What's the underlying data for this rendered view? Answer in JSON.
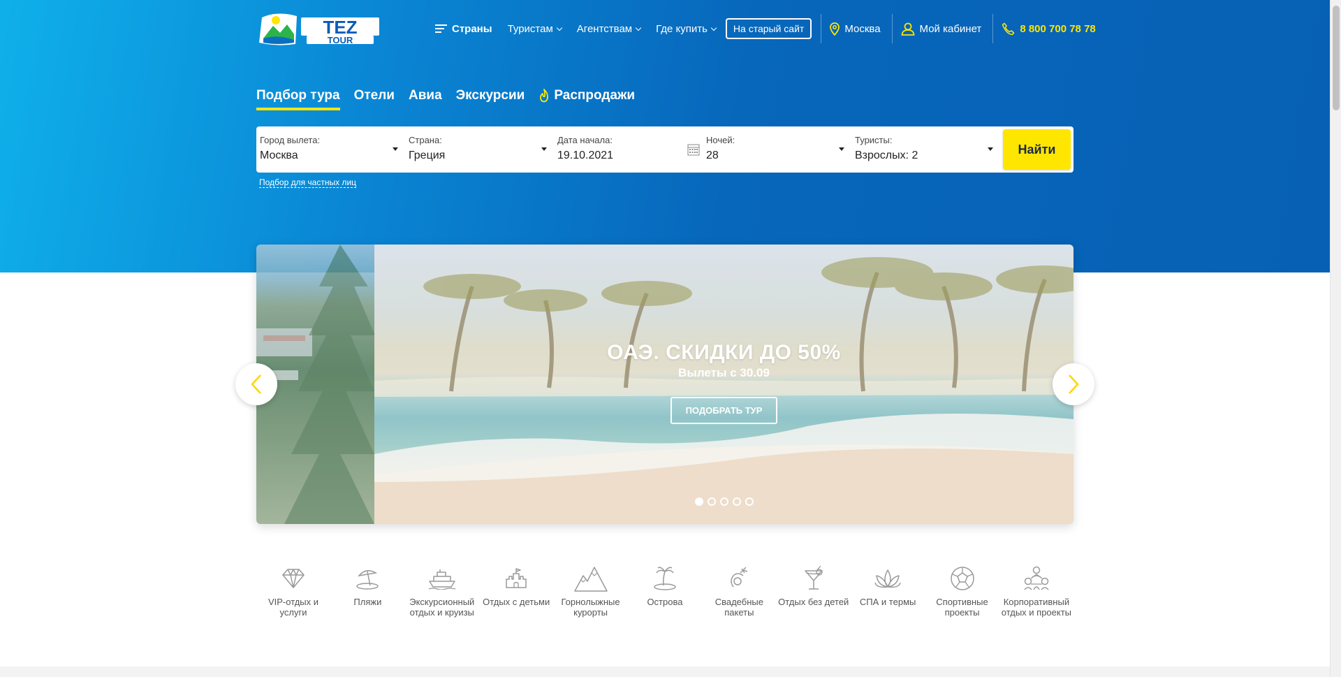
{
  "brand": {
    "logo_line1": "TEZ",
    "logo_line2": "TOUR"
  },
  "header": {
    "nav": [
      {
        "label": "Страны",
        "has_menu_icon": true,
        "dropdown": false
      },
      {
        "label": "Туристам",
        "dropdown": true
      },
      {
        "label": "Агентствам",
        "dropdown": true
      },
      {
        "label": "Где купить",
        "dropdown": true
      }
    ],
    "old_site_label": "На старый сайт",
    "city_label": "Москва",
    "cabinet_label": "Мой кабинет",
    "phone": "8 800 700 78 78"
  },
  "tabs": [
    {
      "label": "Подбор тура",
      "active": true
    },
    {
      "label": "Отели",
      "active": false
    },
    {
      "label": "Авиа",
      "active": false
    },
    {
      "label": "Экскурсии",
      "active": false
    },
    {
      "label": "Распродажи",
      "active": false,
      "icon": "fire-icon"
    }
  ],
  "search": {
    "fields": [
      {
        "label": "Город вылета:",
        "value": "Москва",
        "control": "select"
      },
      {
        "label": "Страна:",
        "value": "Греция",
        "control": "select"
      },
      {
        "label": "Дата начала:",
        "value": "19.10.2021",
        "control": "date"
      },
      {
        "label": "Ночей:",
        "value": "28",
        "control": "select"
      },
      {
        "label": "Туристы:",
        "value": "Взрослых: 2",
        "control": "select"
      }
    ],
    "submit_label": "Найти",
    "private_link": "Подбор для частных лиц"
  },
  "slider": {
    "title": "ОАЭ. СКИДКИ ДО 50%",
    "subtitle": "Вылеты с 30.09",
    "button_label": "ПОДОБРАТЬ ТУР",
    "dots_total": 5,
    "active_dot": 0
  },
  "categories": [
    {
      "label": "VIP-отдых и услуги",
      "icon": "diamond-icon"
    },
    {
      "label": "Пляжи",
      "icon": "beach-umbrella-icon"
    },
    {
      "label": "Экскурсионный отдых и круизы",
      "icon": "cruise-ship-icon"
    },
    {
      "label": "Отдых с детьми",
      "icon": "sandcastle-icon"
    },
    {
      "label": "Горнолыжные курорты",
      "icon": "mountains-icon"
    },
    {
      "label": "Острова",
      "icon": "island-palm-icon"
    },
    {
      "label": "Свадебные пакеты",
      "icon": "wedding-icon"
    },
    {
      "label": "Отдых без детей",
      "icon": "cocktail-icon"
    },
    {
      "label": "СПА и термы",
      "icon": "lotus-icon"
    },
    {
      "label": "Спортивные проекты",
      "icon": "football-icon"
    },
    {
      "label": "Корпоративный отдых и проекты",
      "icon": "team-icon"
    }
  ],
  "colors": {
    "accent_yellow": "#ffe600",
    "header_blue": "#0767bb",
    "hero_light_blue": "#0fb0ea"
  }
}
